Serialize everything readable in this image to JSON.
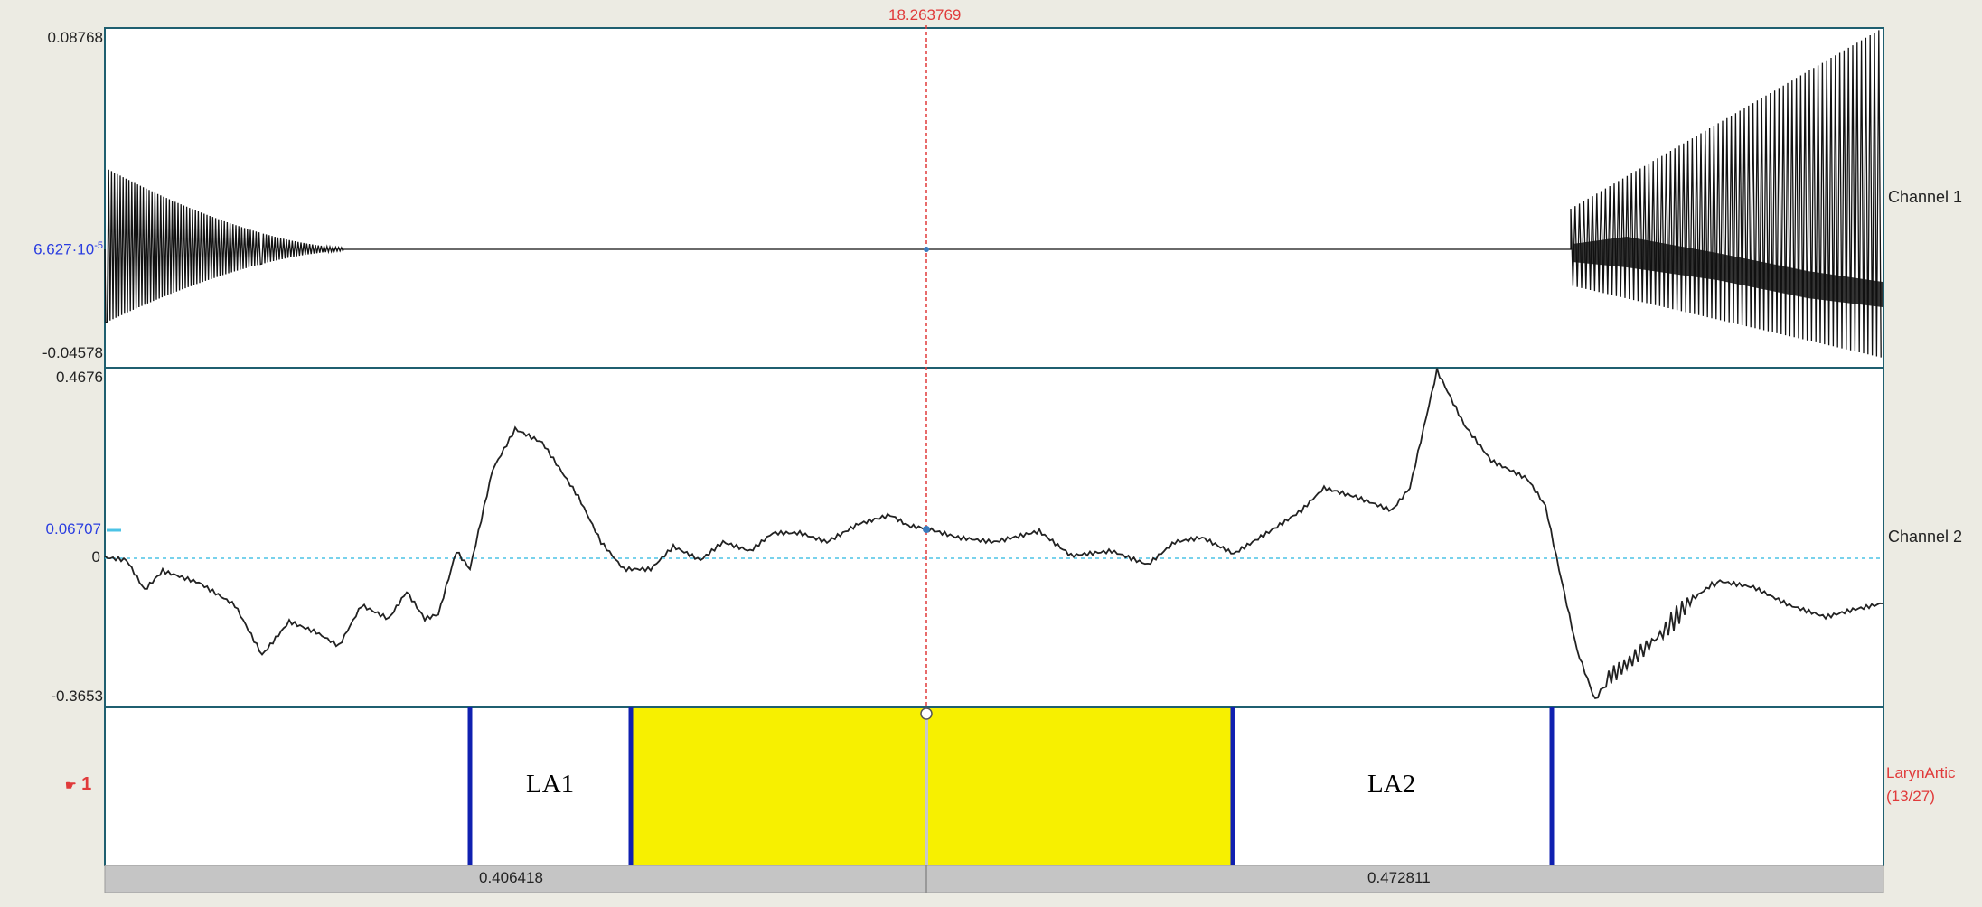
{
  "cursor": {
    "time_label": "18.263769"
  },
  "channel1": {
    "name": "Channel 1",
    "y_max": "0.08768",
    "y_min": "-0.04578",
    "cursor_value": "6.627·10",
    "cursor_value_exp": "-5"
  },
  "channel2": {
    "name": "Channel 2",
    "y_max": "0.4676",
    "y_min": "-0.3653",
    "cursor_value": "0.06707",
    "zero_label": "0"
  },
  "tier": {
    "number_label": "1",
    "name": "LarynArtic",
    "count": "(13/27)",
    "intervals": [
      {
        "label": "LA1",
        "selected": false
      },
      {
        "label": "",
        "selected": true
      },
      {
        "label": "LA2",
        "selected": false
      }
    ]
  },
  "durations": {
    "left": "0.406418",
    "right": "0.472811"
  },
  "colors": {
    "cursor": "#e03a3a",
    "selection": "#f7f000",
    "boundary": "#1020b0",
    "frame": "#1f5f70"
  }
}
